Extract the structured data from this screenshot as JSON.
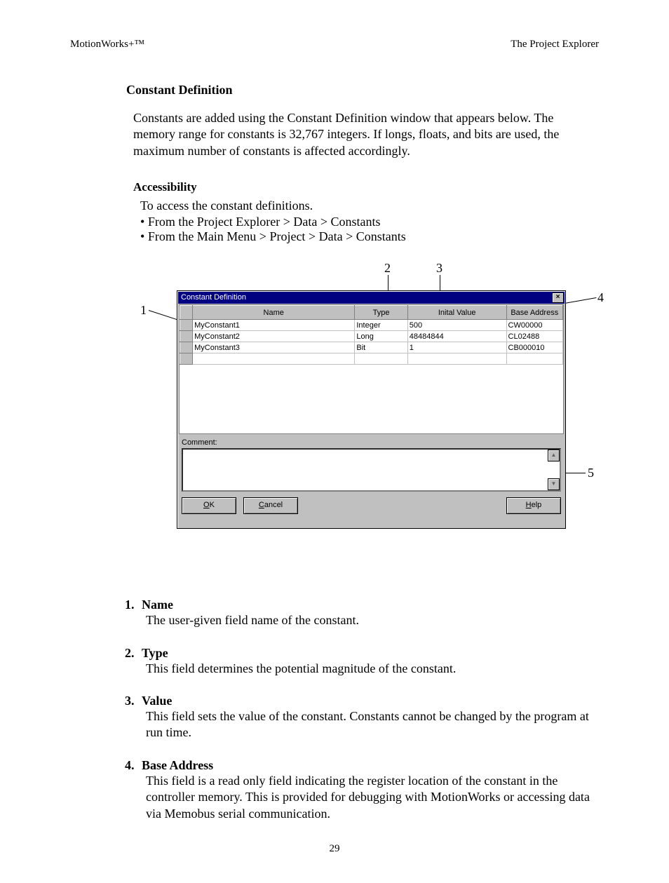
{
  "header": {
    "left": "MotionWorks+™",
    "right": "The Project Explorer"
  },
  "title": "Constant Definition",
  "intro": "Constants are added using the Constant Definition window that appears below.  The memory range for constants is 32,767 integers.  If longs, floats, and bits are used, the maximum number of constants is affected accordingly.",
  "accessibility": {
    "heading": "Accessibility",
    "lead": "To access the constant definitions.",
    "items": [
      "From the Project Explorer > Data > Constants",
      "From the Main Menu > Project > Data > Constants"
    ]
  },
  "callouts": {
    "c1": "1",
    "c2": "2",
    "c3": "3",
    "c4": "4",
    "c5": "5"
  },
  "dialog": {
    "title": "Constant Definition",
    "columns": {
      "name": "Name",
      "type": "Type",
      "value": "Inital Value",
      "base": "Base Address"
    },
    "rows": [
      {
        "name": "MyConstant1",
        "type": "Integer",
        "value": "500",
        "base": "CW00000"
      },
      {
        "name": "MyConstant2",
        "type": "Long",
        "value": "48484844",
        "base": "CL02488"
      },
      {
        "name": "MyConstant3",
        "type": "Bit",
        "value": "1",
        "base": "CB000010"
      }
    ],
    "comment_label": "Comment:",
    "buttons": {
      "ok_u": "O",
      "ok_rest": "K",
      "cancel_u": "C",
      "cancel_rest": "ancel",
      "help_u": "H",
      "help_rest": "elp"
    }
  },
  "definitions": [
    {
      "num": "1.",
      "name": "Name",
      "body": "The user-given field name of the constant."
    },
    {
      "num": "2.",
      "name": "Type",
      "body": "This field determines the potential magnitude of the constant."
    },
    {
      "num": "3.",
      "name": "Value",
      "body": "This field sets the value of the constant.  Constants cannot be changed by the program at run time."
    },
    {
      "num": "4.",
      "name": "Base Address",
      "body": "This field is a read only field indicating the register location of the constant in the controller memory.  This is provided for debugging with MotionWorks or accessing data via Memobus serial communication."
    }
  ],
  "page_number": "29"
}
